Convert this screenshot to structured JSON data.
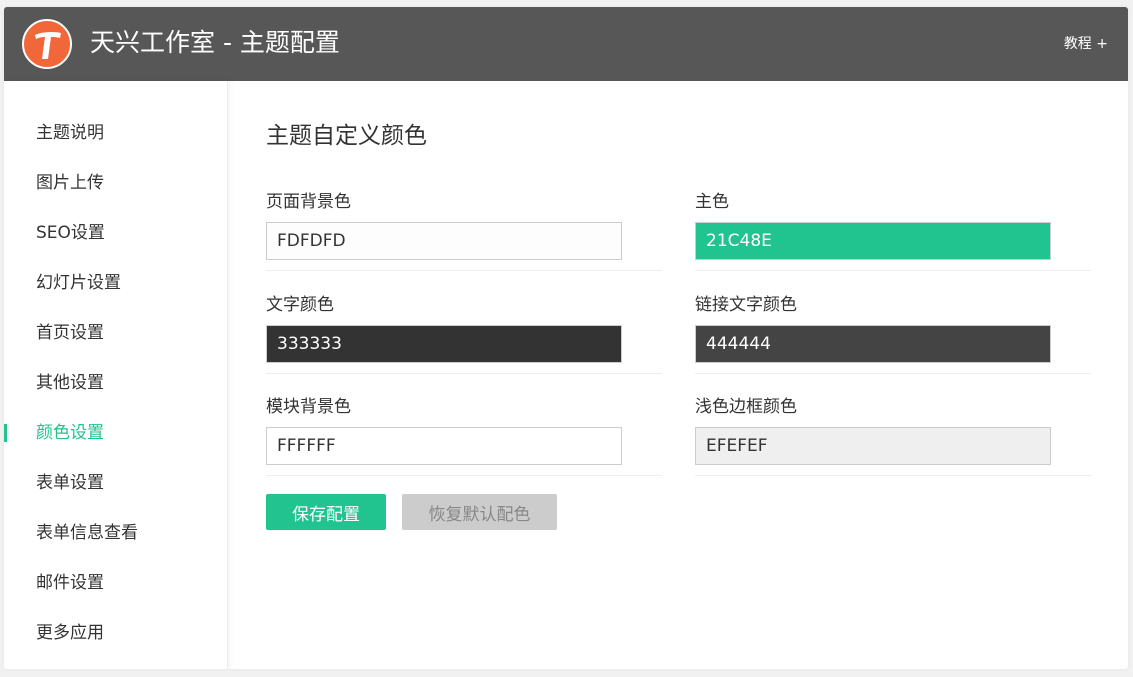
{
  "header": {
    "title": "天兴工作室 - 主题配置",
    "link": "教程 +",
    "logo_color": "#f2673a"
  },
  "sidebar": {
    "items": [
      {
        "label": "主题说明"
      },
      {
        "label": "图片上传"
      },
      {
        "label": "SEO设置"
      },
      {
        "label": "幻灯片设置"
      },
      {
        "label": "首页设置"
      },
      {
        "label": "其他设置"
      },
      {
        "label": "颜色设置",
        "active": true
      },
      {
        "label": "表单设置"
      },
      {
        "label": "表单信息查看"
      },
      {
        "label": "邮件设置"
      },
      {
        "label": "更多应用"
      }
    ]
  },
  "main": {
    "title": "主题自定义颜色",
    "fields": [
      {
        "label": "页面背景色",
        "value": "FDFDFD",
        "bg": "#FDFDFD",
        "fg": "#333333"
      },
      {
        "label": "主色",
        "value": "21C48E",
        "bg": "#21C48E",
        "fg": "#ffffff"
      },
      {
        "label": "文字颜色",
        "value": "333333",
        "bg": "#333333",
        "fg": "#ffffff"
      },
      {
        "label": "链接文字颜色",
        "value": "444444",
        "bg": "#444444",
        "fg": "#ffffff"
      },
      {
        "label": "模块背景色",
        "value": "FFFFFF",
        "bg": "#FFFFFF",
        "fg": "#333333"
      },
      {
        "label": "浅色边框颜色",
        "value": "EFEFEF",
        "bg": "#EFEFEF",
        "fg": "#333333"
      }
    ],
    "save_label": "保存配置",
    "reset_label": "恢复默认配色"
  },
  "colors": {
    "accent": "#21c48e",
    "header_bg": "#575757"
  }
}
